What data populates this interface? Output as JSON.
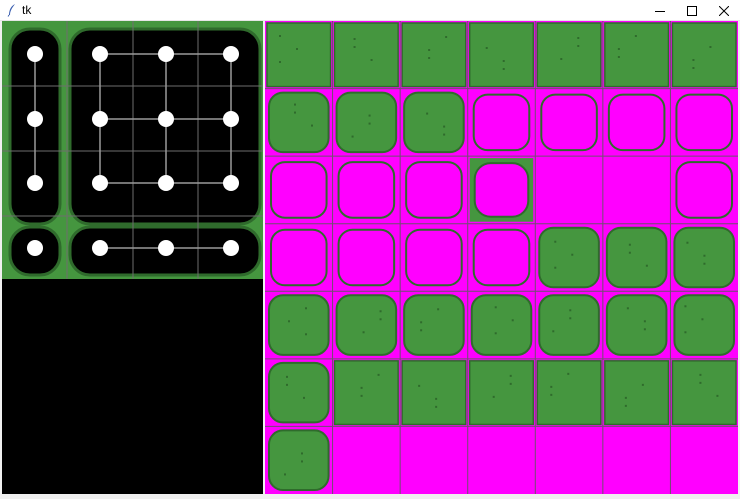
{
  "window": {
    "title": "tk",
    "icon": "feather-icon",
    "controls": [
      "minimize-icon",
      "maximize-icon",
      "close-icon"
    ]
  },
  "colors": {
    "grass": "#45963f",
    "grass_dark": "#2f6b2c",
    "magenta": "#ff00ff",
    "background": "#000000",
    "node": "#ffffff",
    "edge": "#9a9a9a"
  },
  "left_panel": {
    "description_free": true,
    "node_rows": 4,
    "node_cols": 4
  },
  "tileset": {
    "rows": 7,
    "cols": 7,
    "tiles": [
      "full",
      "full",
      "full",
      "full",
      "full",
      "full",
      "full",
      "island",
      "island",
      "island",
      "hole",
      "hole",
      "hole",
      "hole",
      "hole",
      "hole",
      "hole",
      "hole-g",
      "empty",
      "empty",
      "hole",
      "hole",
      "hole",
      "hole",
      "hole",
      "island",
      "island",
      "island",
      "island",
      "island",
      "island",
      "island",
      "island",
      "island",
      "island",
      "island",
      "full",
      "full",
      "full",
      "full",
      "full",
      "full",
      "island",
      "empty",
      "empty",
      "empty",
      "empty",
      "empty",
      "empty"
    ]
  }
}
